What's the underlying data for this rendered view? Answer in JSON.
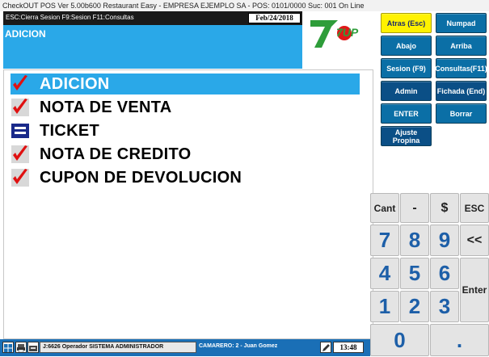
{
  "window": {
    "title": "CheckOUT POS Ver 5.00b600 Restaurant Easy - EMPRESA EJEMPLO SA - POS: 0101/0000 Suc: 001  On Line"
  },
  "header": {
    "hints": "ESC:Cierra Sesion F9:Sesion F11:Consultas",
    "date": "Feb/24/2018",
    "mode": "ADICION"
  },
  "logo": {
    "text": "7UP"
  },
  "function_buttons": [
    {
      "label": "Atras (Esc)"
    },
    {
      "label": "Numpad"
    },
    {
      "label": "Abajo"
    },
    {
      "label": "Arriba"
    },
    {
      "label": "Sesion (F9)"
    },
    {
      "label": "Consultas(F11)"
    },
    {
      "label": "Admin"
    },
    {
      "label": "Fichada (End)"
    },
    {
      "label": "ENTER"
    },
    {
      "label": "Borrar"
    },
    {
      "label": "Ajuste Propina"
    }
  ],
  "menu": {
    "selected_index": 0,
    "items": [
      {
        "label": "ADICION",
        "icon": "check-icon"
      },
      {
        "label": "NOTA DE VENTA",
        "icon": "check-icon"
      },
      {
        "label": "TICKET",
        "icon": "ticket-icon"
      },
      {
        "label": "NOTA DE CREDITO",
        "icon": "check-icon"
      },
      {
        "label": "CUPON DE DEVOLUCION",
        "icon": "check-icon"
      }
    ]
  },
  "keypad": {
    "cant": "Cant",
    "minus": "-",
    "dollar": "$",
    "esc": "ESC",
    "k7": "7",
    "k8": "8",
    "k9": "9",
    "back": "<<",
    "k4": "4",
    "k5": "5",
    "k6": "6",
    "enter": "Enter",
    "k1": "1",
    "k2": "2",
    "k3": "3",
    "k0": "0",
    "dot": "."
  },
  "status": {
    "operator": "J:6626 Operador  SISTEMA ADMINISTRADOR",
    "waiter": "CAMARERO: 2 -  Juan Gomez",
    "time": "13:48"
  },
  "colors": {
    "accent": "#2aa8e8",
    "button": "#0b6fa6",
    "highlight": "#fff200",
    "check": "#e01010",
    "digits": "#1d5fa8"
  }
}
